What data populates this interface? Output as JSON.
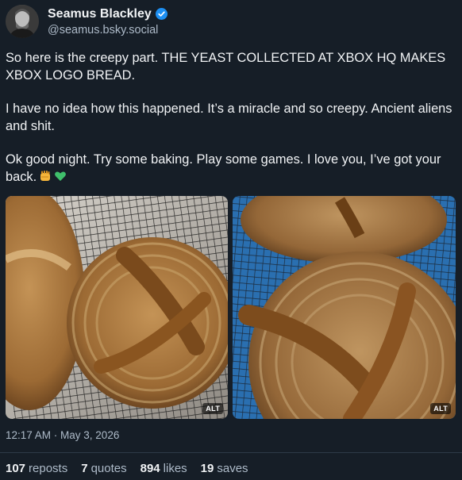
{
  "author": {
    "display_name": "Seamus Blackley",
    "handle": "@seamus.bsky.social"
  },
  "post": {
    "paragraphs": [
      "So here is the creepy part. THE YEAST COLLECTED AT XBOX HQ MAKES XBOX LOGO BREAD.",
      "I have no idea how this happened. It’s a miracle and so creepy. Ancient aliens and shit.",
      "Ok good night. Try some baking. Play some games. I love you, I’ve got your back."
    ],
    "emojis": [
      "fist-emoji",
      "green-heart-emoji"
    ],
    "images": [
      {
        "alt_label": "ALT",
        "icon": "bread-photo"
      },
      {
        "alt_label": "ALT",
        "icon": "bread-photo"
      }
    ],
    "timestamp": "12:17 AM · May 3, 2026"
  },
  "stats": [
    {
      "count": "107",
      "label": "reposts"
    },
    {
      "count": "7",
      "label": "quotes"
    },
    {
      "count": "894",
      "label": "likes"
    },
    {
      "count": "19",
      "label": "saves"
    }
  ],
  "colors": {
    "background": "#161e27",
    "text": "#f1f3f5",
    "muted": "#aebbc9",
    "verified": "#1d8ff2"
  }
}
